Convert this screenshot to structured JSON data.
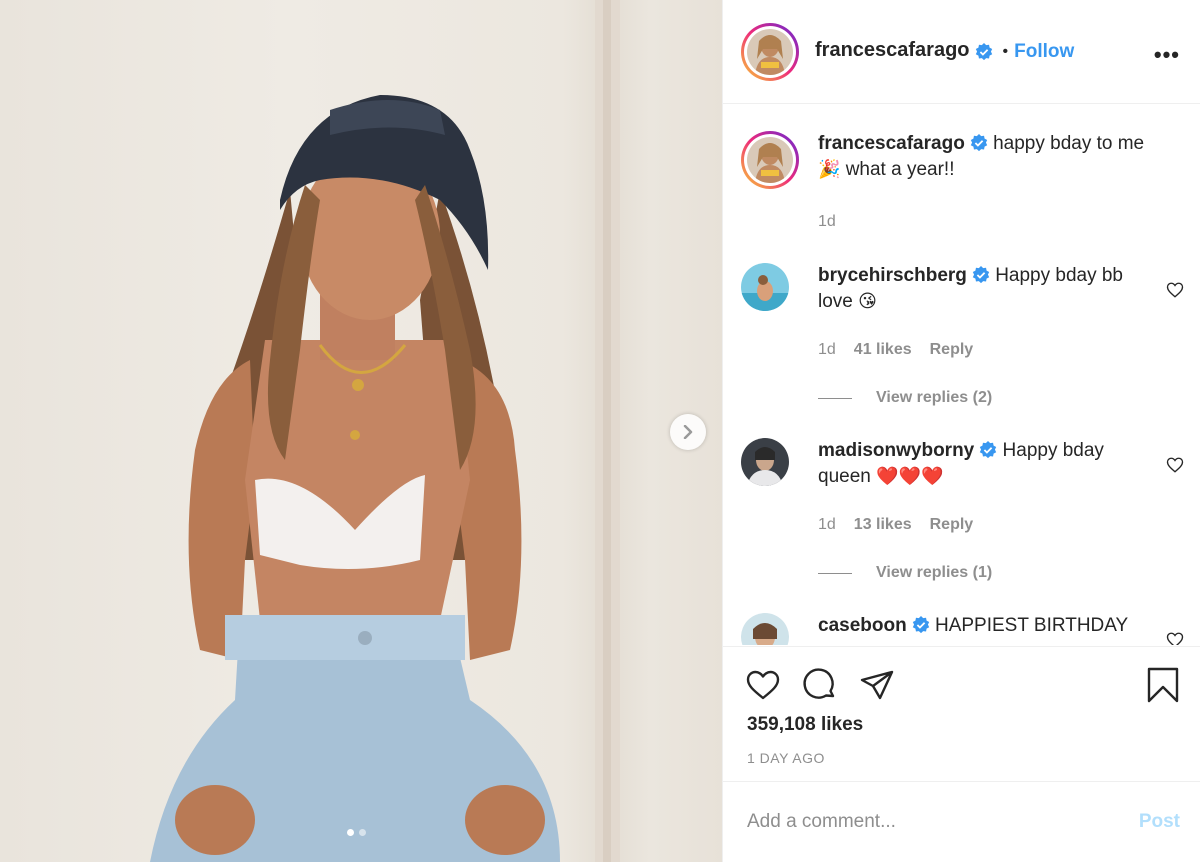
{
  "post": {
    "username": "francescafarago",
    "follow_label": "Follow",
    "separator": "•",
    "more_label": "•••",
    "media": {
      "next_icon": "chevron-right-icon",
      "carousel_count": 2,
      "carousel_active": 0
    },
    "caption": {
      "username": "francescafarago",
      "text_a": "happy bday to me",
      "emoji": "🎉",
      "text_b": "what a year!!",
      "time": "1d"
    },
    "comments": [
      {
        "username": "brycehirschberg",
        "text": "Happy bday bb love",
        "emoji": "😘",
        "time": "1d",
        "likes": "41 likes",
        "reply_label": "Reply",
        "view_replies": "View replies (2)"
      },
      {
        "username": "madisonwyborny",
        "text": "Happy bday queen",
        "emoji": "❤️❤️❤️",
        "time": "1d",
        "likes": "13 likes",
        "reply_label": "Reply",
        "view_replies": "View replies (1)"
      },
      {
        "username": "caseboon",
        "text": "HAPPIEST BIRTHDAY",
        "emoji": "",
        "time": "",
        "likes": "",
        "reply_label": "",
        "view_replies": ""
      }
    ],
    "likes_count": "359,108 likes",
    "timestamp": "1 DAY AGO",
    "add_comment_placeholder": "Add a comment...",
    "post_label": "Post",
    "colors": {
      "accent": "#3897f0",
      "post_disabled": "#b2dffc",
      "muted": "#8e8e8e",
      "text": "#262626"
    }
  }
}
